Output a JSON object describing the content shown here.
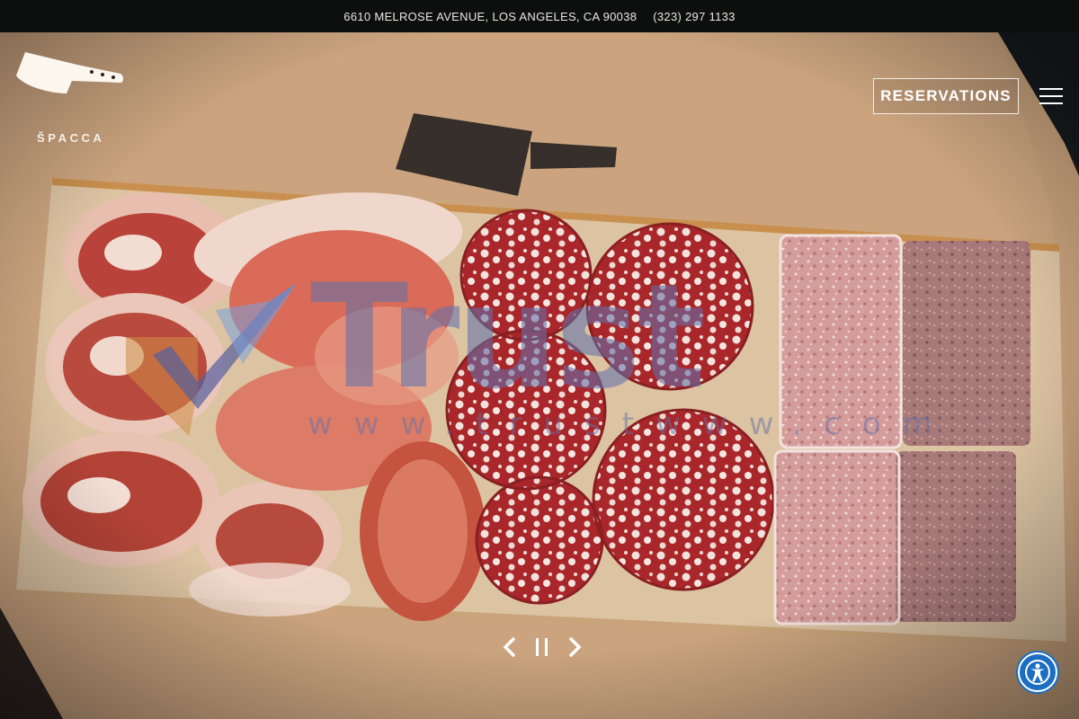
{
  "topbar": {
    "address": "6610 MELROSE AVENUE, LOS ANGELES, CA 90038",
    "phone": "(323) 297 1133"
  },
  "brand": {
    "logo_icon": "cleaver-icon",
    "name": "ŠPACCA"
  },
  "header": {
    "reservations_label": "RESERVATIONS",
    "menu_icon": "hamburger-menu-icon"
  },
  "hero": {
    "image_description": "charcuterie board with cured meats, salami and pâté on brown paper"
  },
  "slider": {
    "prev_icon": "chevron-left-icon",
    "pause_icon": "pause-icon",
    "next_icon": "chevron-right-icon"
  },
  "watermark": {
    "word": "Trust",
    "url": "www.trustwww.com"
  },
  "accessibility": {
    "icon": "accessibility-icon"
  },
  "colors": {
    "topbar_bg": "#0d0e0e",
    "paper": "#c8a482",
    "board": "#dcc2a0",
    "a11y_blue": "#1b6ec2",
    "watermark": "#6270a8"
  }
}
